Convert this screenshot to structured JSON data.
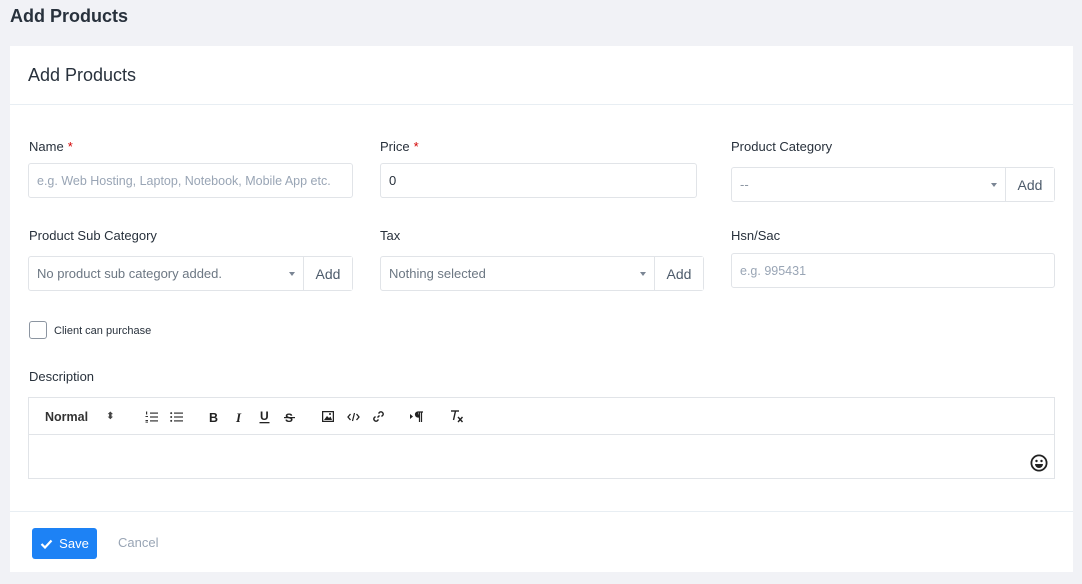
{
  "page": {
    "heading": "Add Products"
  },
  "card": {
    "title": "Add Products"
  },
  "form": {
    "name": {
      "label": "Name",
      "required": "*",
      "placeholder": "e.g. Web Hosting, Laptop, Notebook, Mobile App etc.",
      "value": ""
    },
    "price": {
      "label": "Price",
      "required": "*",
      "value": "0"
    },
    "product_category": {
      "label": "Product Category",
      "selected": "--",
      "add_label": "Add"
    },
    "product_sub_category": {
      "label": "Product Sub Category",
      "selected": "No product sub category added.",
      "add_label": "Add"
    },
    "tax": {
      "label": "Tax",
      "selected": "Nothing selected",
      "add_label": "Add"
    },
    "hsn_sac": {
      "label": "Hsn/Sac",
      "placeholder": "e.g. 995431",
      "value": ""
    },
    "client_can_purchase": {
      "label": "Client can purchase",
      "checked": false
    },
    "description": {
      "label": "Description",
      "toolbar": {
        "heading_select": "Normal",
        "updown": "⬍"
      },
      "value": ""
    }
  },
  "footer": {
    "save_label": "Save",
    "cancel_label": "Cancel"
  },
  "colors": {
    "primary": "#1d82f5",
    "required": "#d30000",
    "background": "#f1f2f6"
  },
  "icons": [
    "ordered-list-icon",
    "bullet-list-icon",
    "bold-icon",
    "italic-icon",
    "underline-icon",
    "strike-icon",
    "image-icon",
    "code-icon",
    "link-icon",
    "text-direction-icon",
    "clear-format-icon",
    "emoji-icon",
    "check-icon"
  ]
}
